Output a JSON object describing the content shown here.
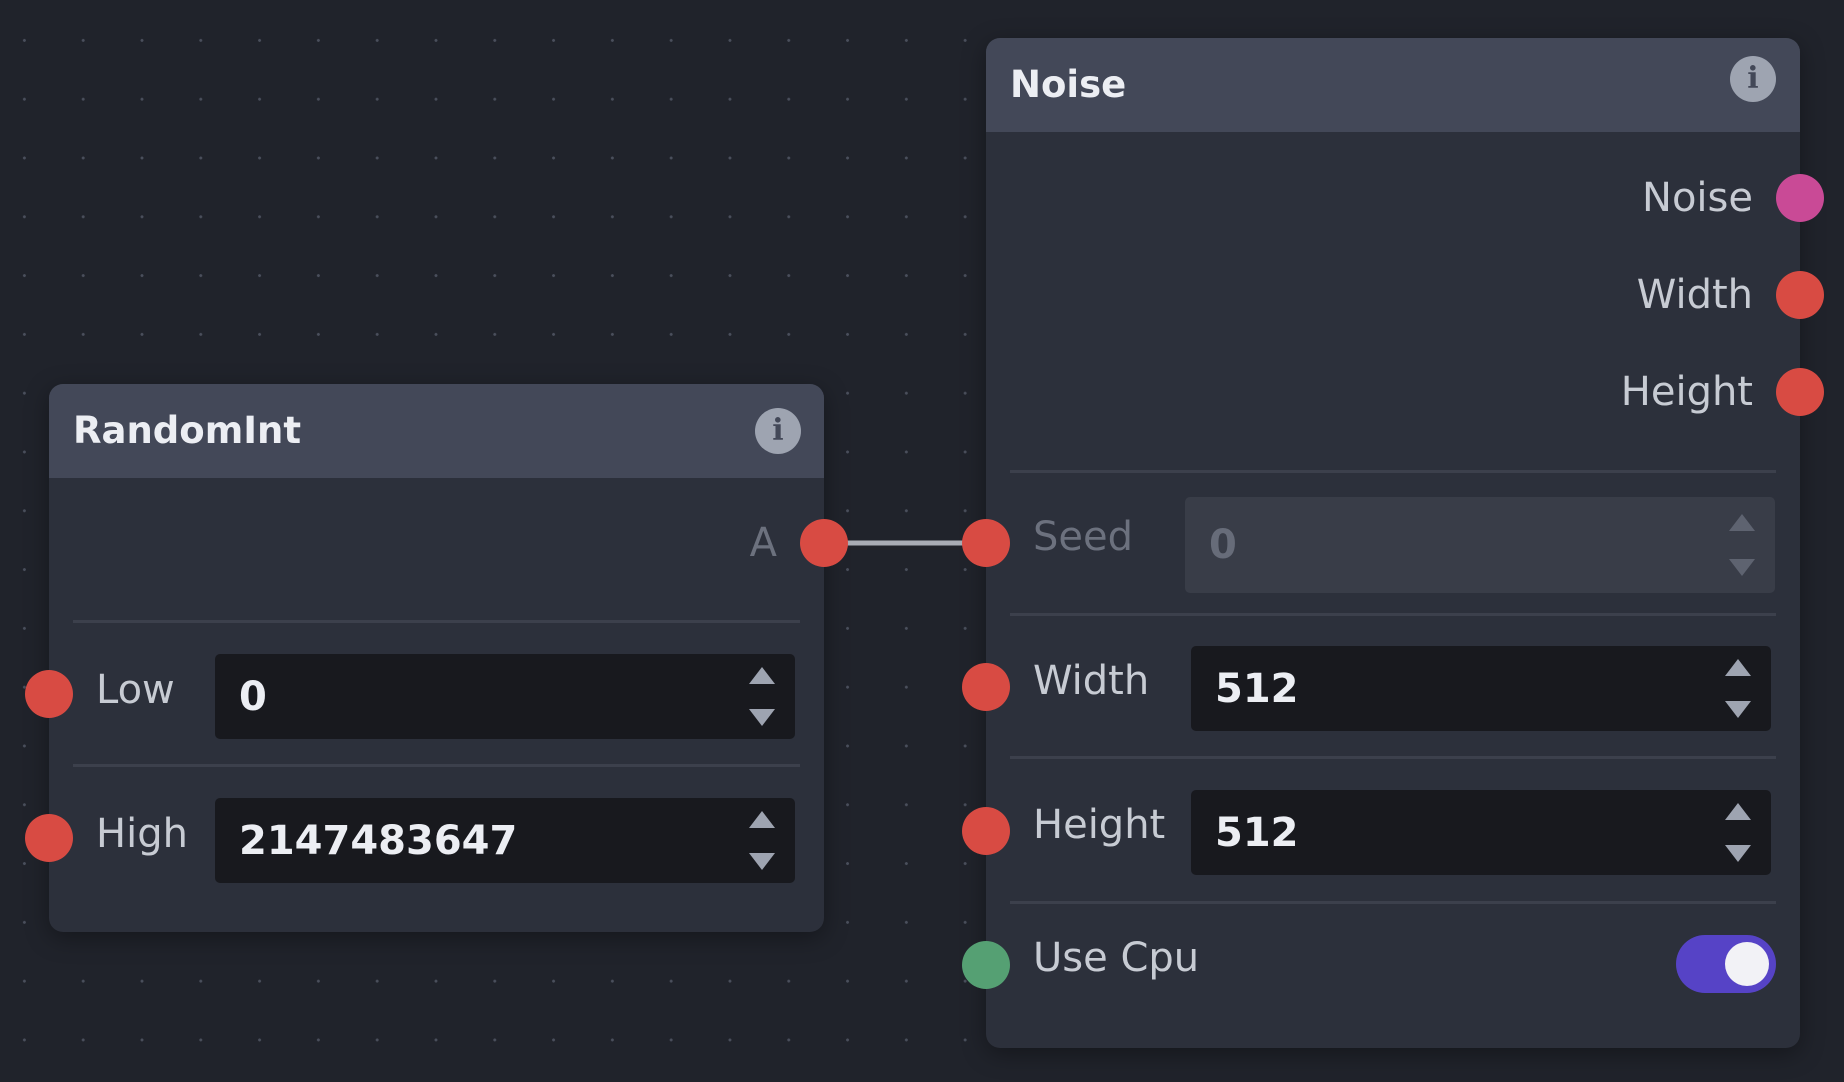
{
  "random_int_node": {
    "title": "RandomInt",
    "output_a": "A",
    "low": {
      "label": "Low",
      "value": "0"
    },
    "high": {
      "label": "High",
      "value": "2147483647"
    }
  },
  "noise_node": {
    "title": "Noise",
    "outputs": {
      "noise": "Noise",
      "width": "Width",
      "height": "Height"
    },
    "seed": {
      "label": "Seed",
      "value": "0"
    },
    "width": {
      "label": "Width",
      "value": "512"
    },
    "height": {
      "label": "Height",
      "value": "512"
    },
    "use_cpu": {
      "label": "Use Cpu",
      "enabled": true
    }
  },
  "icons": {
    "info": "info-icon"
  },
  "colors": {
    "canvas_bg": "#20232b",
    "node_bg": "#2c303b",
    "header_bg": "#434858",
    "socket_int": "#d84b43",
    "socket_image": "#c94a96",
    "socket_bool": "#55a073",
    "toggle_on": "#5643c6"
  }
}
